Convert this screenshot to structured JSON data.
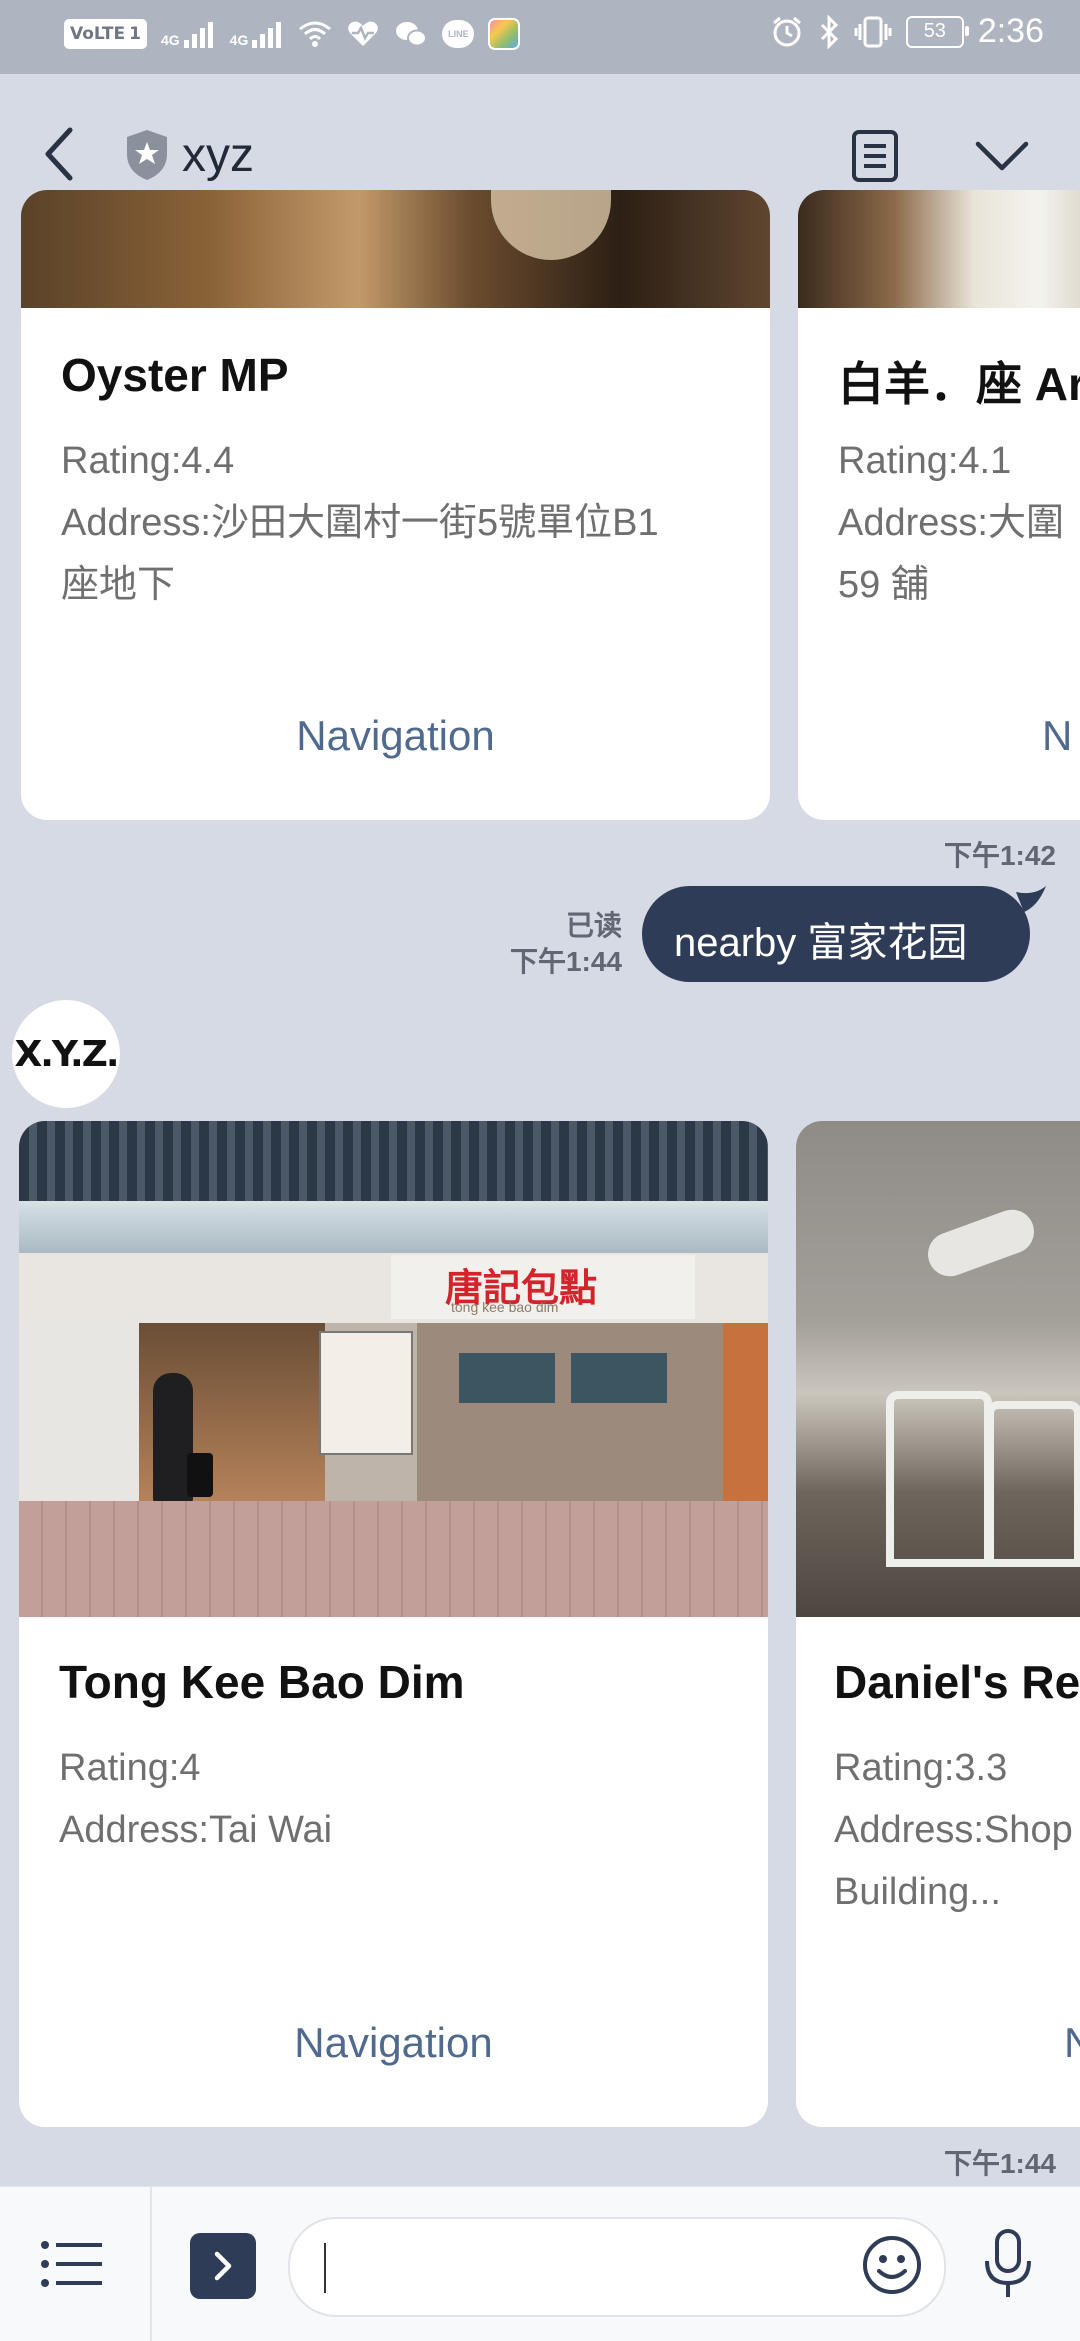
{
  "status_bar": {
    "volte": "VoLTE",
    "sim": "1",
    "net1": "4G",
    "net2": "4G",
    "line_badge": "LINE",
    "battery": "53",
    "time": "2:36"
  },
  "header": {
    "title": "xyz"
  },
  "top_cards": [
    {
      "name": "Oyster MP",
      "rating": "Rating:4.4",
      "address_line1": "Address:沙田大圍村一街5號單位B1",
      "address_line2": "座地下",
      "nav": "Navigation"
    },
    {
      "name": "白羊．座 Ar",
      "rating": "Rating:4.1",
      "address_line1": "Address:大圍",
      "address_line2": "59 舖",
      "nav": "N"
    }
  ],
  "messages": {
    "time1": "下午1:42",
    "read_label": "已读",
    "outgoing_time": "下午1:44",
    "outgoing_text": "nearby 富家花园",
    "bot_avatar_text": "X.Y.Z.",
    "time2": "下午1:44"
  },
  "bottom_cards": [
    {
      "name": "Tong Kee Bao Dim",
      "rating": "Rating:4",
      "address_line1": "Address:Tai Wai",
      "address_line2": "",
      "nav": "Navigation",
      "sign_cn": "唐記包點",
      "sign_en": "tong kee bao dim"
    },
    {
      "name": "Daniel's Res",
      "rating": "Rating:3.3",
      "address_line1": "Address:Shop",
      "address_line2": "Building...",
      "nav": "N"
    }
  ],
  "input": {
    "placeholder": ""
  },
  "colors": {
    "chat_bg": "#d5dae4",
    "outgoing_bubble": "#2f3c57",
    "nav_link": "#4f6a8e",
    "send_button": "#2f3c57"
  }
}
